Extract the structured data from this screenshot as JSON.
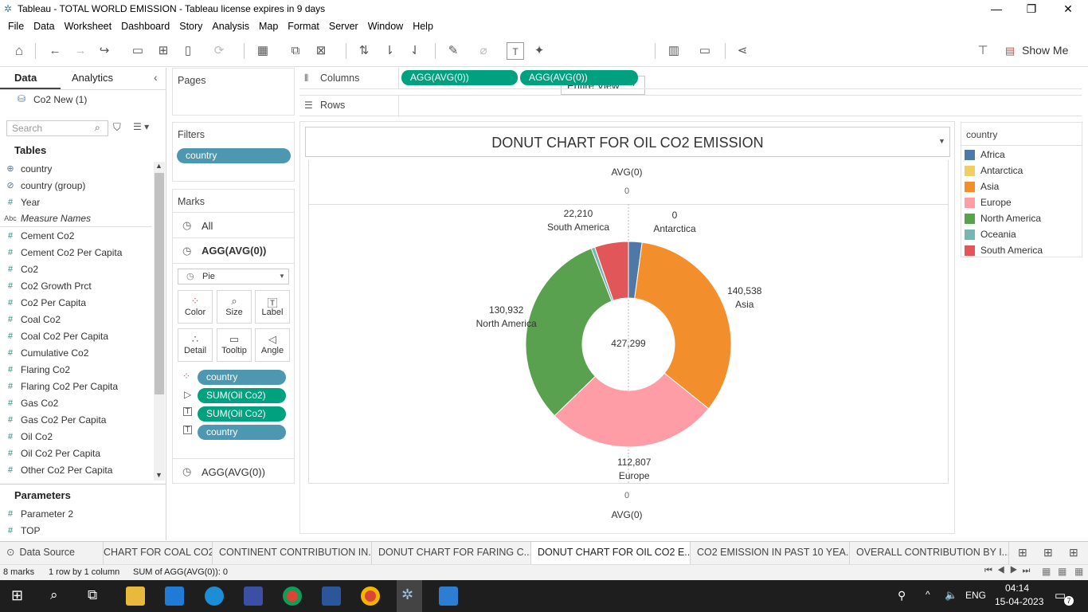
{
  "window": {
    "title": "Tableau - TOTAL WORLD EMISSION - Tableau license expires in 9 days"
  },
  "menu": [
    "File",
    "Data",
    "Worksheet",
    "Dashboard",
    "Story",
    "Analysis",
    "Map",
    "Format",
    "Server",
    "Window",
    "Help"
  ],
  "toolbar": {
    "view_select": "Entire View",
    "show_me": "Show Me"
  },
  "left_panel": {
    "tab_data": "Data",
    "tab_analytics": "Analytics",
    "datasource": "Co2 New (1)",
    "search_placeholder": "Search",
    "tables_header": "Tables",
    "fields": [
      {
        "icon": "⊕",
        "name": "country"
      },
      {
        "icon": "⊘",
        "name": "country (group)"
      },
      {
        "icon": "#",
        "name": "Year"
      },
      {
        "icon": "Abc",
        "name": "Measure Names"
      },
      {
        "icon": "#",
        "name": "Cement Co2"
      },
      {
        "icon": "#",
        "name": "Cement Co2 Per Capita"
      },
      {
        "icon": "#",
        "name": "Co2"
      },
      {
        "icon": "#",
        "name": "Co2 Growth Prct"
      },
      {
        "icon": "#",
        "name": "Co2 Per Capita"
      },
      {
        "icon": "#",
        "name": "Coal Co2"
      },
      {
        "icon": "#",
        "name": "Coal Co2 Per Capita"
      },
      {
        "icon": "#",
        "name": "Cumulative Co2"
      },
      {
        "icon": "#",
        "name": "Flaring Co2"
      },
      {
        "icon": "#",
        "name": "Flaring Co2 Per Capita"
      },
      {
        "icon": "#",
        "name": "Gas Co2"
      },
      {
        "icon": "#",
        "name": "Gas Co2 Per Capita"
      },
      {
        "icon": "#",
        "name": "Oil Co2"
      },
      {
        "icon": "#",
        "name": "Oil Co2 Per Capita"
      },
      {
        "icon": "#",
        "name": "Other Co2 Per Capita"
      }
    ],
    "parameters_header": "Parameters",
    "parameters": [
      {
        "icon": "#",
        "name": "Parameter 2"
      },
      {
        "icon": "#",
        "name": "TOP"
      }
    ]
  },
  "cards": {
    "pages": "Pages",
    "filters": "Filters",
    "filter_pill": "country",
    "marks": "Marks",
    "marks_all": "All",
    "marks_agg1": "AGG(AVG(0))",
    "mark_type": "Pie",
    "btn_color": "Color",
    "btn_size": "Size",
    "btn_label": "Label",
    "btn_detail": "Detail",
    "btn_tooltip": "Tooltip",
    "btn_angle": "Angle",
    "mark_pills": [
      "country",
      "SUM(Oil Co2)",
      "SUM(Oil Co2)",
      "country"
    ],
    "marks_agg2": "AGG(AVG(0))"
  },
  "shelves": {
    "columns": "Columns",
    "rows": "Rows",
    "col_pill_1": "AGG(AVG(0))",
    "col_pill_2": "AGG(AVG(0))"
  },
  "view": {
    "title": "DONUT CHART FOR OIL CO2 EMISSION",
    "top_axis_label": "AVG(0)",
    "top_axis_tick": "0",
    "bottom_axis_tick": "0",
    "bottom_axis_label": "AVG(0)",
    "center_label": "427,299"
  },
  "legend": {
    "title": "country"
  },
  "chart_data": {
    "type": "pie",
    "title": "DONUT CHART FOR OIL CO2 EMISSION",
    "total": 427299,
    "slices": [
      {
        "label": "Africa",
        "value": 8900,
        "value_label": "",
        "color": "#4e79a7"
      },
      {
        "label": "Antarctica",
        "value": 0,
        "value_label": "0",
        "color": "#f1ce63"
      },
      {
        "label": "Asia",
        "value": 140538,
        "value_label": "140,538",
        "color": "#f28e2b"
      },
      {
        "label": "Europe",
        "value": 112807,
        "value_label": "112,807",
        "color": "#ff9da7"
      },
      {
        "label": "North America",
        "value": 130932,
        "value_label": "130,932",
        "color": "#59a14f"
      },
      {
        "label": "Oceania",
        "value": 2420,
        "value_label": "",
        "color": "#76b7b2"
      },
      {
        "label": "South America",
        "value": 22210,
        "value_label": "22,210",
        "color": "#e15759"
      }
    ],
    "legend_placement": "right"
  },
  "tabs": {
    "data_source": "Data Source",
    "sheets": [
      "CHART FOR COAL CO2",
      "CONTINENT CONTRIBUTION IN...",
      "DONUT CHART FOR FARING C...",
      "DONUT CHART FOR OIL CO2 E...",
      "CO2 EMISSION IN PAST 10 YEA...",
      "OVERALL CONTRIBUTION BY I..."
    ]
  },
  "status": {
    "marks": "8 marks",
    "rows_cols": "1 row by 1 column",
    "sum": "SUM of AGG(AVG(0)): 0"
  },
  "taskbar": {
    "lang": "ENG",
    "time": "04:14",
    "date": "15-04-2023",
    "notif": "7"
  }
}
